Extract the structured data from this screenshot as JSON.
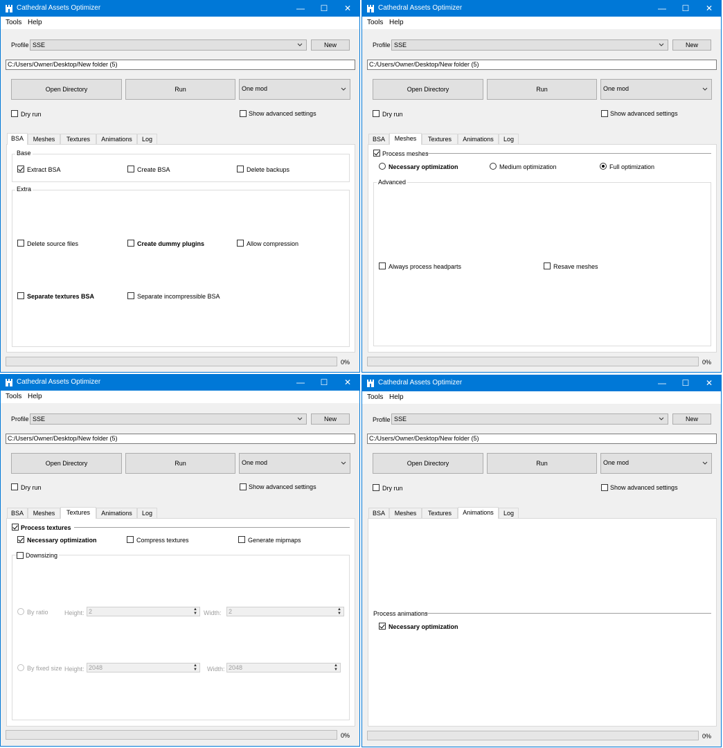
{
  "app": {
    "title": "Cathedral Assets Optimizer"
  },
  "menu": {
    "tools": "Tools",
    "help": "Help"
  },
  "top": {
    "profile_label": "Profile",
    "profile_value": "SSE",
    "new_button": "New",
    "path": "C:/Users/Owner/Desktop/New folder (5)",
    "open_directory": "Open Directory",
    "run": "Run",
    "mode_value": "One mod",
    "dry_run": "Dry run",
    "show_advanced": "Show advanced settings",
    "progress_text": "0%",
    "progress_value": 0
  },
  "tabs": {
    "bsa": "BSA",
    "meshes": "Meshes",
    "textures": "Textures",
    "animations": "Animations",
    "log": "Log"
  },
  "bsa": {
    "base_title": "Base",
    "extract": "Extract BSA",
    "create": "Create BSA",
    "delete_backups": "Delete backups",
    "extra_title": "Extra",
    "delete_source": "Delete source files",
    "dummy_plugins": "Create dummy plugins",
    "allow_compression": "Allow compression",
    "separate_textures": "Separate textures BSA",
    "separate_incompressible": "Separate incompressible BSA"
  },
  "meshes": {
    "process": "Process meshes",
    "necessary": "Necessary optimization",
    "medium": "Medium optimization",
    "full": "Full optimization",
    "advanced_title": "Advanced",
    "headparts": "Always process headparts",
    "resave": "Resave meshes"
  },
  "textures": {
    "process": "Process textures",
    "necessary": "Necessary optimization",
    "compress": "Compress textures",
    "mipmaps": "Generate mipmaps",
    "downsizing": "Downsizing",
    "by_ratio": "By ratio",
    "height_label": "Height:",
    "width_label": "Width:",
    "ratio_height": "2",
    "ratio_width": "2",
    "by_fixed": "By fixed size",
    "fixed_height": "2048",
    "fixed_width": "2048"
  },
  "animations": {
    "process_title": "Process animations",
    "necessary": "Necessary optimization"
  },
  "icons": {
    "app": "castle-icon",
    "minimize": "minimize-icon",
    "maximize": "maximize-icon",
    "close": "close-icon",
    "dropdown": "chevron-down-icon",
    "spin": "spin-arrows-icon"
  },
  "colors": {
    "titlebar": "#0078d7",
    "window_bg": "#f0f0f0",
    "pane_bg": "#ffffff"
  }
}
